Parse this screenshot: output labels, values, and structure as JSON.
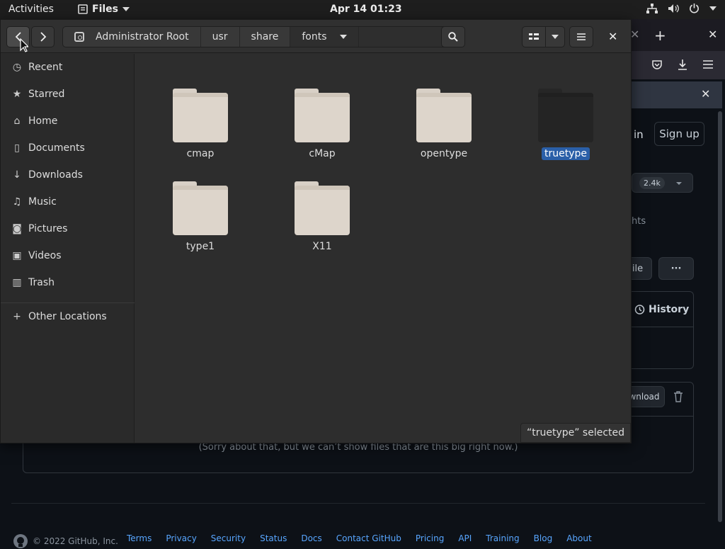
{
  "topbar": {
    "activities": "Activities",
    "app_name": "Files",
    "clock": "Apr 14  01:23"
  },
  "browser": {
    "sign_in_partial": "in",
    "sign_up": "Sign up",
    "star_count": "2.4k",
    "insights_partial": "hts",
    "file_partial": "ile",
    "more": "···",
    "history": "History",
    "download_partial": "wnload",
    "too_big_message": "(Sorry about that, but we can’t show files that are this big right now.)",
    "footer_copyright": "© 2022 GitHub, Inc.",
    "footer_links": [
      "Terms",
      "Privacy",
      "Security",
      "Status",
      "Docs",
      "Contact GitHub",
      "Pricing",
      "API",
      "Training",
      "Blog",
      "About"
    ]
  },
  "files": {
    "path": [
      "Administrator Root",
      "usr",
      "share",
      "fonts"
    ],
    "sidebar": [
      {
        "label": "Recent",
        "icon": "clock-icon"
      },
      {
        "label": "Starred",
        "icon": "star-icon"
      },
      {
        "label": "Home",
        "icon": "home-icon"
      },
      {
        "label": "Documents",
        "icon": "document-icon"
      },
      {
        "label": "Downloads",
        "icon": "download-icon"
      },
      {
        "label": "Music",
        "icon": "music-icon"
      },
      {
        "label": "Pictures",
        "icon": "camera-icon"
      },
      {
        "label": "Videos",
        "icon": "video-icon"
      },
      {
        "label": "Trash",
        "icon": "trash-icon"
      },
      {
        "label": "Other Locations",
        "icon": "plus-icon"
      }
    ],
    "folders": [
      "cmap",
      "cMap",
      "opentype",
      "truetype",
      "type1",
      "X11"
    ],
    "selected_folder": "truetype",
    "status": "“truetype” selected"
  }
}
